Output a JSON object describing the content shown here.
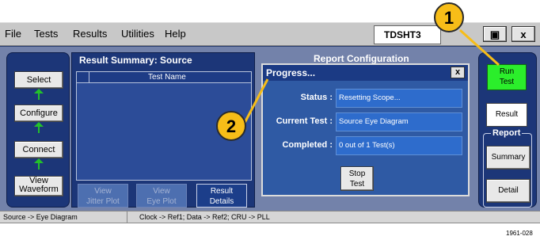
{
  "menubar": {
    "items": [
      "File",
      "Tests",
      "Results",
      "Utilities",
      "Help"
    ],
    "app_title": "TDSHT3",
    "win_btn1": "▣",
    "win_btn2": "x"
  },
  "left_nav": {
    "buttons": [
      "Select",
      "Configure",
      "Connect",
      "View\nWaveform"
    ]
  },
  "summary": {
    "title": "Result Summary: Source",
    "column_header": "Test Name",
    "buttons": [
      {
        "label": "View\nJitter Plot",
        "enabled": false
      },
      {
        "label": "View\nEye Plot",
        "enabled": false
      },
      {
        "label": "Result\nDetails",
        "enabled": true
      }
    ]
  },
  "report_config": {
    "title": "Report Configuration"
  },
  "dialog": {
    "title": "Progress...",
    "close_label": "x",
    "status_label": "Status :",
    "status_value": "Resetting Scope...",
    "current_test_label": "Current Test :",
    "current_test_value": "Source Eye Diagram",
    "completed_label": "Completed :",
    "completed_value": "0 out of 1 Test(s)",
    "stop_button": "Stop\nTest"
  },
  "right_panel": {
    "run_button": "Run\nTest",
    "result_button": "Result",
    "report_group": "Report",
    "summary_button": "Summary",
    "detail_button": "Detail"
  },
  "status_bar": {
    "left": "Source -> Eye Diagram",
    "right": "Clock -> Ref1; Data -> Ref2; CRU -> PLL"
  },
  "callouts": [
    "1",
    "2"
  ],
  "figure_id": "1961-028",
  "colors": {
    "panel_blue": "#1c3678",
    "dialog_blue": "#2f5aa4",
    "run_green": "#2bee2b",
    "callout_yellow": "#f7bd18",
    "arrow_green": "#23c12a"
  }
}
